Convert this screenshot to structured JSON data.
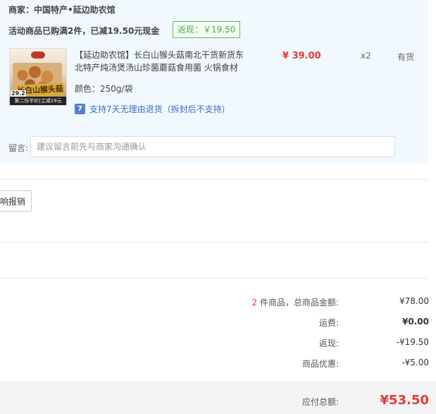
{
  "shop": {
    "merchant": "商家：中国特产•延边助农馆",
    "promo": "活动商品已购满2件，已减19.50元现金",
    "cashback_badge": "返现：￥19.50"
  },
  "product": {
    "image_band_text": "长白山猴头菇",
    "image_strip_text": "第二份半价|立减19元",
    "image_num": "29.2",
    "title": "【延边助农馆】长白山猴头菇南北干货新货东北特产炖汤煲汤山珍菌蘑菇食用菌 火锅食材",
    "price": "¥ 39.00",
    "quantity": "x2",
    "stock": "有货",
    "spec": "颜色：250g/袋",
    "return_icon": "7",
    "return_policy": "支持7天无理由退货（拆封后不支持）"
  },
  "note": {
    "label": "留言:",
    "placeholder": "建议留言前先与商家沟通确认"
  },
  "invoice": {
    "button_label": "响报销"
  },
  "summary": {
    "items_count": "2",
    "items_label": " 件商品，总商品金额:",
    "items_total": "¥78.00",
    "shipping_label": "运费:",
    "shipping": "¥0.00",
    "cashback_label": "返现:",
    "cashback": "-¥19.50",
    "discount_label": "商品优惠:",
    "discount": "-¥5.00",
    "payable_label": "应付总额:",
    "payable": "¥53.50"
  },
  "colors": {
    "accent_red": "#e4393c",
    "panel_bg": "#f1f9ff",
    "badge_green": "#5cbc5c",
    "link_blue": "#3e6dc4"
  }
}
